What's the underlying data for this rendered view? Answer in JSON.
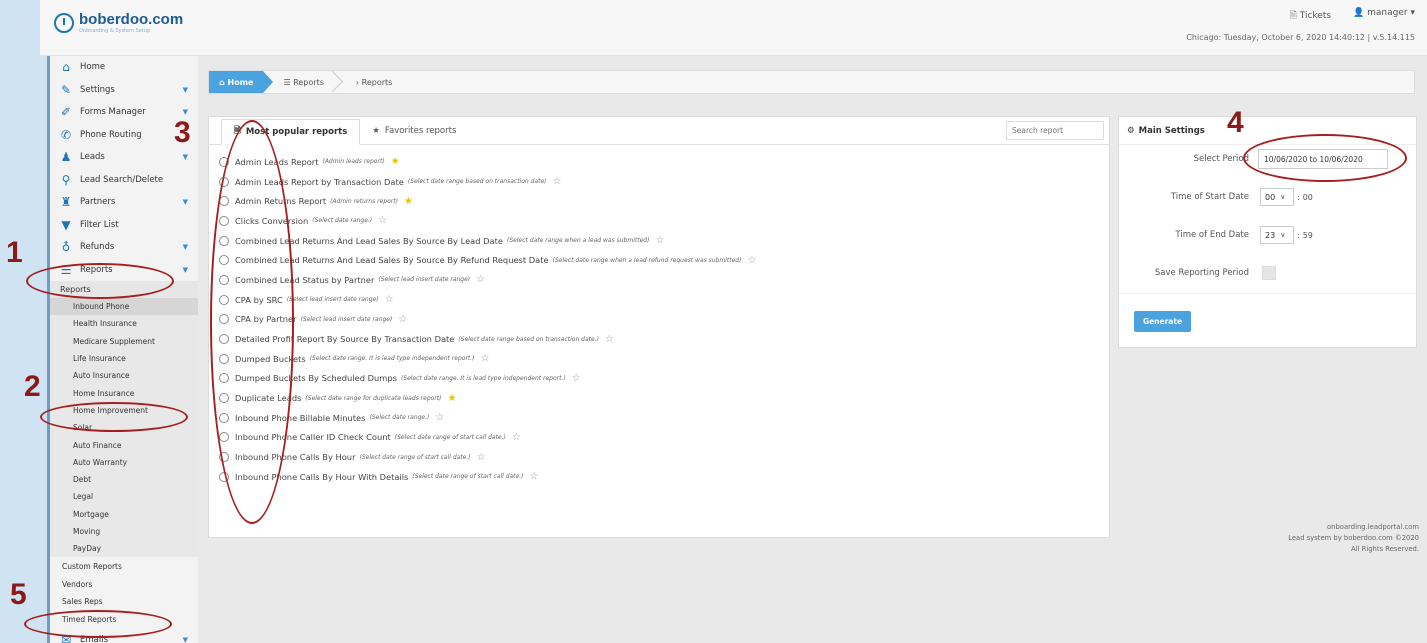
{
  "header": {
    "logo_text": "boberdoo.com",
    "logo_sub": "Onboarding & System Setup",
    "tickets_label": "Tickets",
    "user_label": "manager",
    "info": "Chicago: Tuesday, October 6, 2020 14:40:12 | v.5.14.115"
  },
  "sidebar": {
    "main_items": [
      {
        "label": "Home",
        "icon": "home-icon"
      },
      {
        "label": "Settings",
        "icon": "wrench-icon"
      },
      {
        "label": "Forms Manager",
        "icon": "edit-icon"
      },
      {
        "label": "Phone Routing",
        "icon": "phone-icon"
      },
      {
        "label": "Leads",
        "icon": "users-icon"
      },
      {
        "label": "Lead Search/Delete",
        "icon": "search-icon"
      },
      {
        "label": "Partners",
        "icon": "partners-icon"
      },
      {
        "label": "Filter List",
        "icon": "filter-icon"
      },
      {
        "label": "Refunds",
        "icon": "refund-icon"
      },
      {
        "label": "Reports",
        "icon": "reports-icon"
      }
    ],
    "reports_head": "Reports",
    "report_subitems": [
      "Inbound Phone",
      "Health Insurance",
      "Medicare Supplement",
      "Life Insurance",
      "Auto Insurance",
      "Home Insurance",
      "Home Improvement",
      "Solar",
      "Auto Finance",
      "Auto Warranty",
      "Debt",
      "Legal",
      "Mortgage",
      "Moving",
      "PayDay"
    ],
    "bottom_items": [
      "Custom Reports",
      "Vendors",
      "Sales Reps",
      "Timed Reports"
    ],
    "emails_label": "Emails"
  },
  "breadcrumb": {
    "home": "Home",
    "reports": "Reports",
    "current": "Reports"
  },
  "reports_panel": {
    "tab_popular": "Most popular reports",
    "tab_favorites": "Favorites reports",
    "search_placeholder": "Search report",
    "items": [
      {
        "name": "Admin Leads Report",
        "desc": "(Admin leads report)",
        "fav": true
      },
      {
        "name": "Admin Leads Report by Transaction Date",
        "desc": "(Select date range based on transaction date)",
        "fav": false
      },
      {
        "name": "Admin Returns Report",
        "desc": "(Admin returns report)",
        "fav": true
      },
      {
        "name": "Clicks Conversion",
        "desc": "(Select date range.)",
        "fav": false
      },
      {
        "name": "Combined Lead Returns And Lead Sales By Source By Lead Date",
        "desc": "(Select date range when a lead was submitted)",
        "fav": false
      },
      {
        "name": "Combined Lead Returns And Lead Sales By Source By Refund Request Date",
        "desc": "(Select date range when a lead refund request was submitted)",
        "fav": false
      },
      {
        "name": "Combined Lead Status by Partner",
        "desc": "(Select lead insert date range)",
        "fav": false
      },
      {
        "name": "CPA by SRC",
        "desc": "(Select lead insert date range)",
        "fav": false
      },
      {
        "name": "CPA by Partner",
        "desc": "(Select lead insert date range)",
        "fav": false
      },
      {
        "name": "Detailed Profit Report By Source By Transaction Date",
        "desc": "(Select date range based on transaction date.)",
        "fav": false
      },
      {
        "name": "Dumped Buckets",
        "desc": "(Select date range. It is lead type independent report.)",
        "fav": false
      },
      {
        "name": "Dumped Buckets By Scheduled Dumps",
        "desc": "(Select date range. It is lead type independent report.)",
        "fav": false
      },
      {
        "name": "Duplicate Leads",
        "desc": "(Select date range for duplicate leads report)",
        "fav": true
      },
      {
        "name": "Inbound Phone Billable Minutes",
        "desc": "(Select date range.)",
        "fav": false
      },
      {
        "name": "Inbound Phone Caller ID Check Count",
        "desc": "(Select date range of start call date.)",
        "fav": false
      },
      {
        "name": "Inbound Phone Calls By Hour",
        "desc": "(Select date range of start call date.)",
        "fav": false
      },
      {
        "name": "Inbound Phone Calls By Hour With Details",
        "desc": "(Select date range of start call date.)",
        "fav": false
      }
    ]
  },
  "settings": {
    "title": "Main Settings",
    "period_label": "Select Period",
    "period_value": "10/06/2020 to 10/06/2020",
    "start_label": "Time of Start Date",
    "start_hour": "00",
    "start_min": "00",
    "end_label": "Time of End Date",
    "end_hour": "23",
    "end_min": "59",
    "save_label": "Save Reporting Period",
    "generate_label": "Generate"
  },
  "footer": {
    "line1": "onboarding.leadportal.com",
    "line2": "Lead system by boberdoo.com ©2020",
    "line3": "All Rights Reserved."
  },
  "annotations": [
    "1",
    "2",
    "3",
    "4",
    "5"
  ],
  "colors": {
    "accent": "#4aa3df",
    "annotation": "#8b1a1a",
    "favorite_star": "#f2c200"
  }
}
